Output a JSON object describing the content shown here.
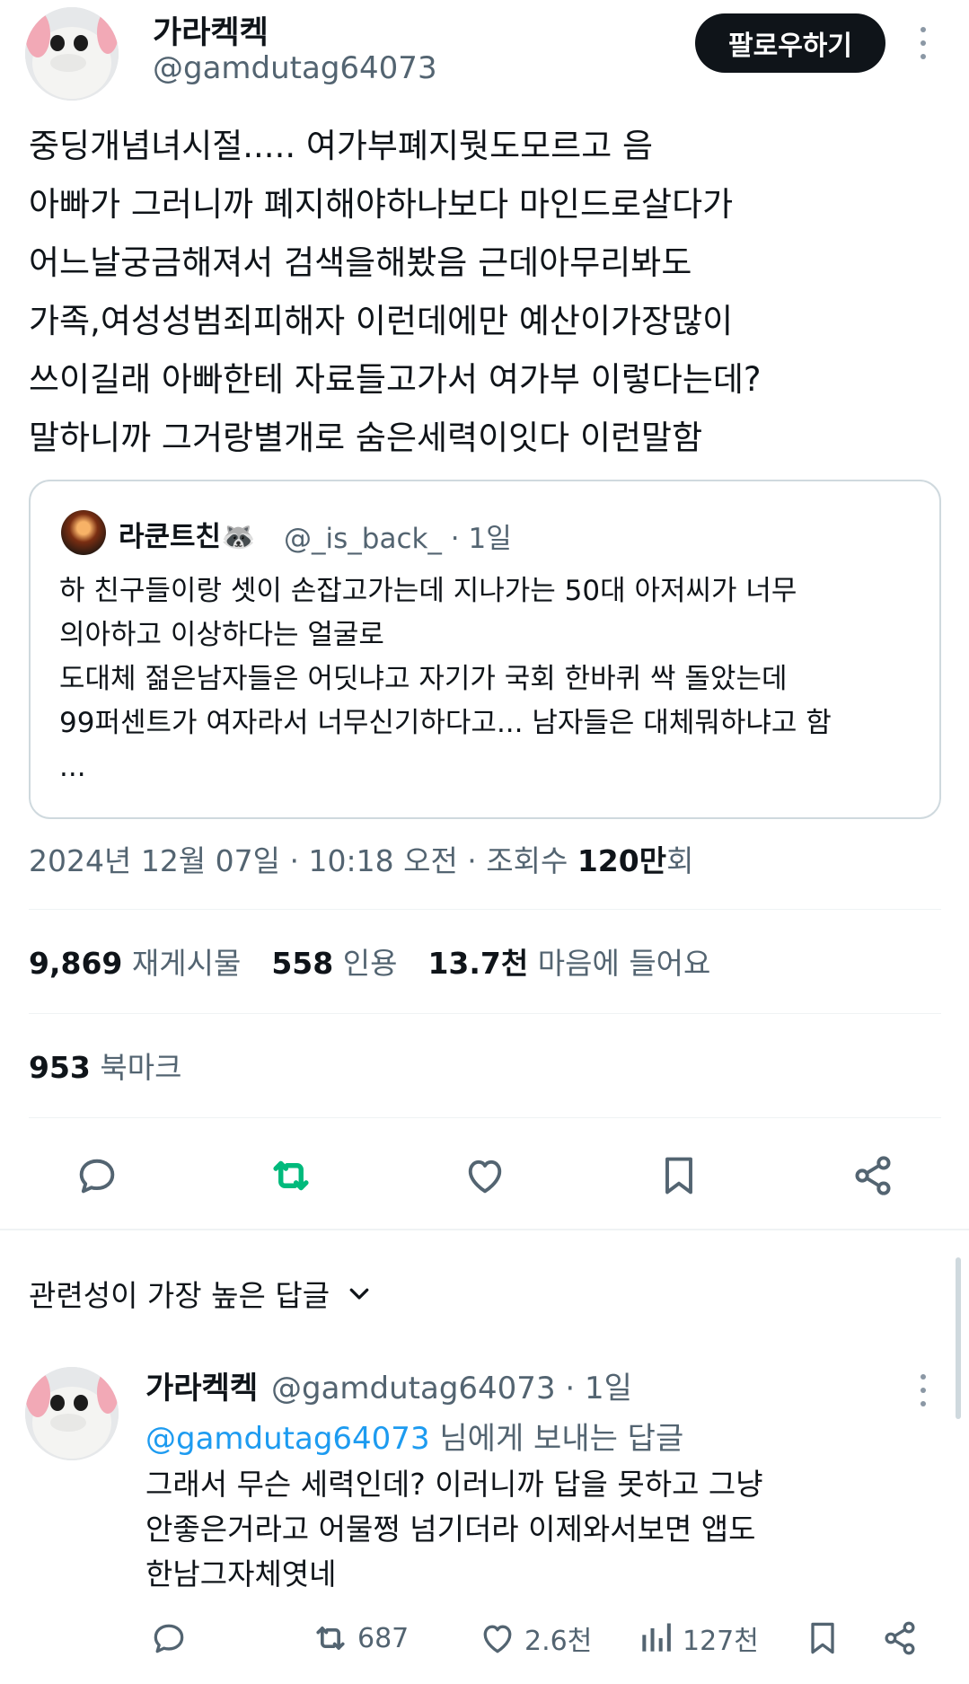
{
  "tweet": {
    "author_name": "가라켁켁",
    "author_handle": "@gamdutag64073",
    "follow_label": "팔로우하기",
    "body": "중딩개념녀시절..... 여가부폐지뭣도모르고 음\n아빠가 그러니까 폐지해야하나보다 마인드로살다가\n어느날궁금해져서 검색을해봤음 근데아무리봐도\n가족,여성성범죄피해자 이런데에만 예산이가장많이\n쓰이길래 아빠한테 자료들고가서 여가부 이렇다는데?\n말하니까 그거랑별개로 숨은세력이잇다 이런말함",
    "quote": {
      "name": "라쿤트친🦝",
      "handle": "@_is_back_ · 1일",
      "text": "하 친구들이랑 셋이 손잡고가는데 지나가는 50대 아저씨가 너무\n의아하고 이상하다는 얼굴로\n도대체 젊은남자들은 어딧냐고 자기가 국회 한바퀴 싹 돌았는데\n99퍼센트가 여자라서 너무신기하다고... 남자들은 대체뭐하냐고 함\n..."
    },
    "timestamp_prefix": "2024년 12월 07일 · 10:18 오전 · 조회수 ",
    "views_count": "120만",
    "views_suffix": "회",
    "stats": {
      "reposts_count": "9,869",
      "reposts_label": "재게시물",
      "quotes_count": "558",
      "quotes_label": "인용",
      "likes_count": "13.7천",
      "likes_label": "마음에 들어요",
      "bookmarks_count": "953",
      "bookmarks_label": "북마크"
    },
    "action_icons": [
      "reply-icon",
      "retweet-icon",
      "heart-icon",
      "bookmark-icon",
      "share-icon"
    ],
    "retweet_color": "#00ba7c"
  },
  "replies_sort": {
    "label": "관련성이 가장 높은 답글"
  },
  "reply": {
    "author_name": "가라켁켁",
    "handle_time": "@gamdutag64073 · 1일",
    "reply_to_handle": "@gamdutag64073",
    "reply_to_suffix": " 님에게 보내는 답글",
    "text": "그래서 무슨 세력인데? 이러니까 답을 못하고 그냥\n안좋은거라고 어물쩡 넘기더라 이제와서보면 앱도\n한남그자체엿네",
    "retweets": "687",
    "likes": "2.6천",
    "views": "127천"
  },
  "colors": {
    "text_primary": "#0f1419",
    "text_secondary": "#536471",
    "link": "#1d9bf0",
    "border": "#cfd9de"
  }
}
